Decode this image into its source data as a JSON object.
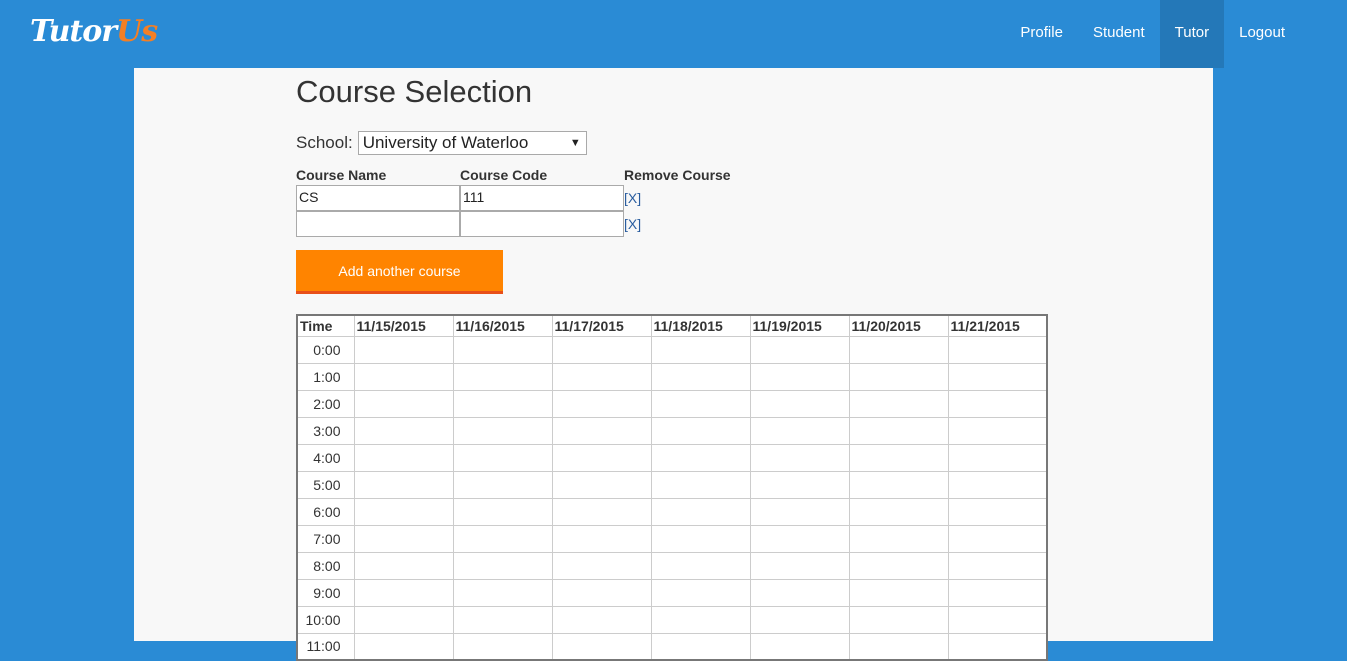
{
  "brand": {
    "part1": "Tutor",
    "part2": "Us"
  },
  "nav": {
    "items": [
      {
        "label": "Profile",
        "active": false
      },
      {
        "label": "Student",
        "active": false
      },
      {
        "label": "Tutor",
        "active": true
      },
      {
        "label": "Logout",
        "active": false
      }
    ]
  },
  "page": {
    "title": "Course Selection"
  },
  "school": {
    "label": "School:",
    "selected": "University of Waterloo"
  },
  "courses": {
    "headers": {
      "name": "Course Name",
      "code": "Course Code",
      "remove": "Remove Course"
    },
    "rows": [
      {
        "name": "CS",
        "code": "111",
        "remove": "[X]"
      },
      {
        "name": "",
        "code": "",
        "remove": "[X]"
      }
    ]
  },
  "add_button": {
    "label": "Add another course"
  },
  "schedule": {
    "time_header": "Time",
    "dates": [
      "11/15/2015",
      "11/16/2015",
      "11/17/2015",
      "11/18/2015",
      "11/19/2015",
      "11/20/2015",
      "11/21/2015"
    ],
    "times": [
      "0:00",
      "1:00",
      "2:00",
      "3:00",
      "4:00",
      "5:00",
      "6:00",
      "7:00",
      "8:00",
      "9:00",
      "10:00",
      "11:00"
    ]
  },
  "colors": {
    "nav_bg": "#2a8bd5",
    "nav_active": "#2478b8",
    "accent": "#ff8400",
    "brand_accent": "#f47f24",
    "content_bg": "#f8f8f8"
  }
}
